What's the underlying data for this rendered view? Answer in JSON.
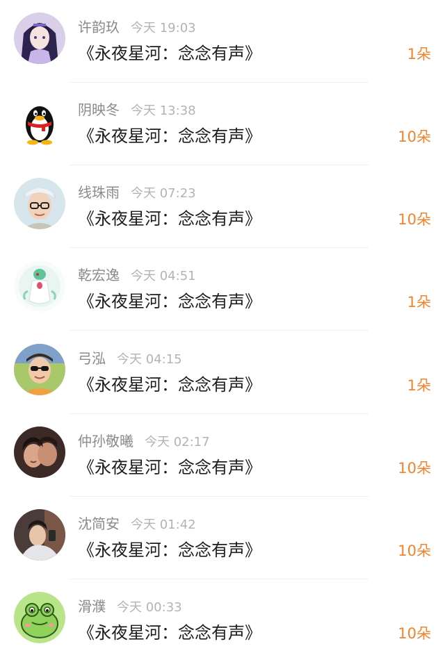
{
  "colors": {
    "name": "#8a8a8a",
    "time": "#b3b3b3",
    "work_title": "#1c1c1c",
    "gift_count": "#f0832c",
    "divider": "#efefef"
  },
  "entries": [
    {
      "name": "许韵玖",
      "time": "今天 19:03",
      "work": "《永夜星河：念念有声》",
      "gift": "1朵",
      "avatar_icon": "anime-girl-avatar-icon"
    },
    {
      "name": "阴映冬",
      "time": "今天 13:38",
      "work": "《永夜星河：念念有声》",
      "gift": "10朵",
      "avatar_icon": "penguin-avatar-icon"
    },
    {
      "name": "线珠雨",
      "time": "今天 07:23",
      "work": "《永夜星河：念念有声》",
      "gift": "10朵",
      "avatar_icon": "person-glasses-avatar-icon"
    },
    {
      "name": "乾宏逸",
      "time": "今天 04:51",
      "work": "《永夜星河：念念有声》",
      "gift": "1朵",
      "avatar_icon": "cartoon-creature-avatar-icon"
    },
    {
      "name": "弓泓",
      "time": "今天 04:15",
      "work": "《永夜星河：念念有声》",
      "gift": "1朵",
      "avatar_icon": "person-sunglasses-avatar-icon"
    },
    {
      "name": "仲孙敬曦",
      "time": "今天 02:17",
      "work": "《永夜星河：念念有声》",
      "gift": "10朵",
      "avatar_icon": "couple-photo-avatar-icon"
    },
    {
      "name": "沈简安",
      "time": "今天 01:42",
      "work": "《永夜星河：念念有声》",
      "gift": "10朵",
      "avatar_icon": "person-photo-avatar-icon"
    },
    {
      "name": "滑濮",
      "time": "今天 00:33",
      "work": "《永夜星河：念念有声》",
      "gift": "10朵",
      "avatar_icon": "frog-avatar-icon"
    }
  ]
}
